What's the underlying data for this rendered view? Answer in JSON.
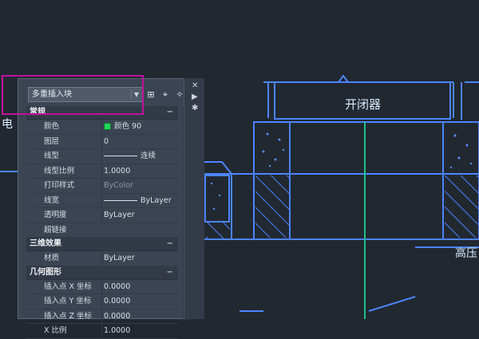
{
  "drawing": {
    "switchgear_label": "开闭器",
    "left_edge_text": "电",
    "right_edge_text": "高压"
  },
  "palette": {
    "block_select": "多重插入块",
    "groups": [
      {
        "title": "常规",
        "collapse": "−",
        "rows": [
          {
            "label": "颜色",
            "value": "颜色 90",
            "kind": "color",
            "swatch": "#22d85b"
          },
          {
            "label": "图层",
            "value": "0"
          },
          {
            "label": "线型",
            "value": "连续",
            "kind": "linetype"
          },
          {
            "label": "线型比例",
            "value": "1.0000"
          },
          {
            "label": "打印样式",
            "value": "ByColor",
            "dim": true
          },
          {
            "label": "线宽",
            "value": "ByLayer",
            "kind": "linetype"
          },
          {
            "label": "透明度",
            "value": "ByLayer"
          },
          {
            "label": "超链接",
            "value": ""
          }
        ]
      },
      {
        "title": "三维效果",
        "collapse": "−",
        "rows": [
          {
            "label": "材质",
            "value": "ByLayer"
          }
        ]
      },
      {
        "title": "几何图形",
        "collapse": "−",
        "rows": [
          {
            "label": "插入点 X 坐标",
            "value": "0.0000"
          },
          {
            "label": "插入点 Y 坐标",
            "value": "0.0000"
          },
          {
            "label": "插入点 Z 坐标",
            "value": "0.0000"
          },
          {
            "label": "X 比例",
            "value": "1.0000"
          }
        ]
      }
    ],
    "side_buttons": [
      "✕",
      "▶",
      "✱"
    ]
  },
  "colors": {
    "canvas": "#212830",
    "cad_line": "#4d84ff",
    "cad_green": "#1fbf8a",
    "highlight": "#c0139f"
  }
}
